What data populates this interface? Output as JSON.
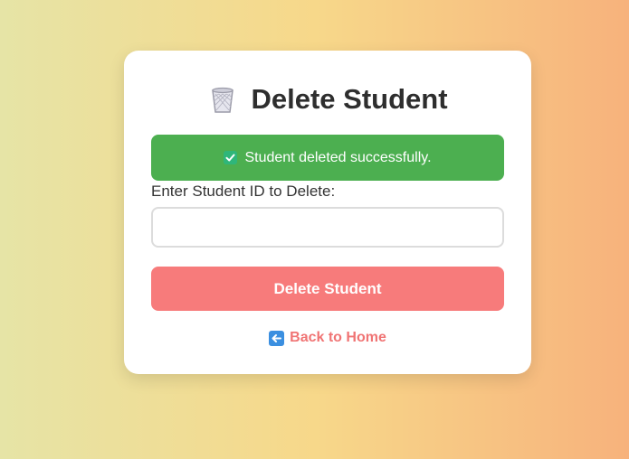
{
  "page": {
    "title": "Delete Student",
    "title_icon": "wastebasket-icon"
  },
  "alert": {
    "icon": "check-mark-icon",
    "message": "Student deleted successfully.",
    "color": "#4caf50"
  },
  "form": {
    "label": "Enter Student ID to Delete:",
    "input_value": "",
    "input_placeholder": "",
    "submit_label": "Delete Student",
    "submit_color": "#f77b7b"
  },
  "nav": {
    "back_icon": "left-arrow-icon",
    "back_label": "Back to Home",
    "link_color": "#f07474"
  }
}
